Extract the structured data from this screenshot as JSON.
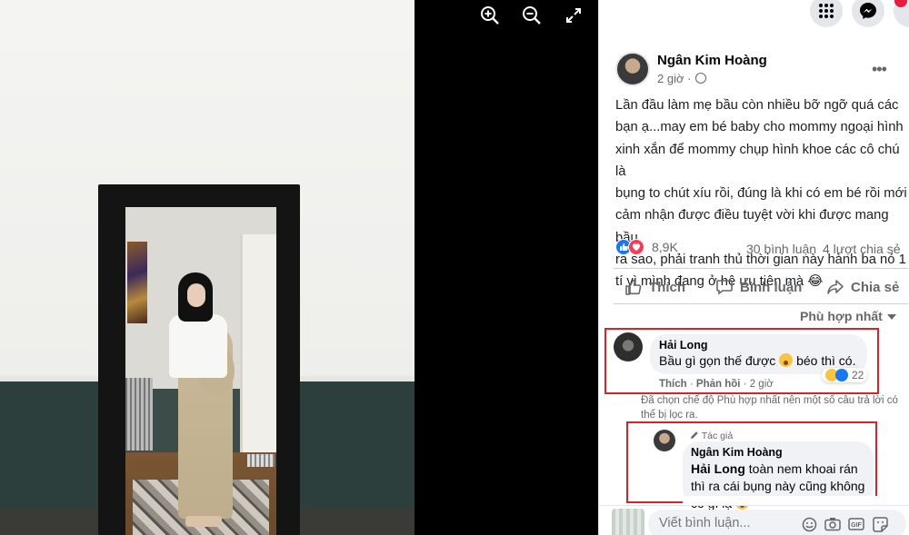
{
  "viewer": {
    "controls": [
      "zoom-in",
      "zoom-out",
      "fullscreen"
    ]
  },
  "post": {
    "author": "Ngân Kim Hoàng",
    "time": "2 giờ ·",
    "text": "Lần đầu làm mẹ bầu còn nhiều bỡ ngỡ quá các\nbạn ạ...may em bé baby cho mommy ngoại hình\nxinh xắn để mommy chụp hình khoe các cô chú là\nbụng to chút xíu rồi, đúng là khi có em bé rồi mới\ncảm nhận được điều tuyệt vời khi được mang bầu\nra sao, phải tranh thủ thời gian này hành ba nó 1\ntí vì mình đang ở hệ ưu tiên mà 😂",
    "reaction_count": "8,9K",
    "comment_count": "30 bình luận",
    "share_count": "4 lượt chia sẻ"
  },
  "actions": {
    "like": "Thích",
    "comment": "Bình luận",
    "share": "Chia sẻ"
  },
  "sort_label": "Phù hợp nhất",
  "comments": [
    {
      "name": "Hải Long",
      "text_before": "Bầu gì gọn thế được",
      "text_after": "béo thì có.",
      "reaction_count": "22",
      "like": "Thích",
      "reply": "Phản hồi",
      "time": "2 giờ"
    }
  ],
  "filter_note": "Đã chọn chế độ Phù hợp nhất nên một số câu trả lời có thể bị lọc ra.",
  "reply": {
    "badge": "Tác giả",
    "name": "Ngân Kim Hoàng",
    "tag": "Hải Long",
    "text": "toàn nem khoai rán thì ra cái bụng này cũng không có gì lạ"
  },
  "composer": {
    "placeholder": "Viết bình luận..."
  },
  "colors": {
    "accent": "#1877f2",
    "highlight_box": "#d8232a",
    "love": "#f33e58"
  }
}
